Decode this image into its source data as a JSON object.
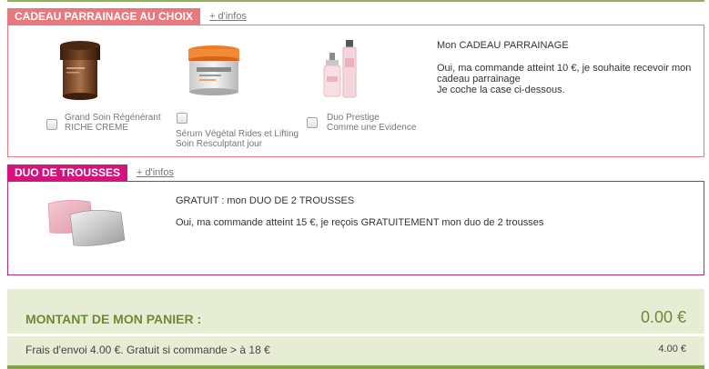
{
  "parrainage": {
    "tag": "CADEAU PARRAINAGE AU CHOIX",
    "info_link": "+ d'infos",
    "products": [
      {
        "line1": "Grand Soin Régénérant",
        "line2": "RICHE CREME",
        "checked": false,
        "icon": "cream-jar-icon"
      },
      {
        "line1": "Sérum Végétal Rides et Lifting",
        "line2": "Soin Resculptant jour",
        "checked": false,
        "icon": "serum-jar-icon"
      },
      {
        "line1": "Duo Prestige",
        "line2": "Comme une Evidence",
        "checked": false,
        "icon": "perfume-duo-icon"
      }
    ],
    "title": "Mon CADEAU PARRAINAGE",
    "text_line1": "Oui, ma commande atteint 10 €, je souhaite recevoir mon",
    "text_line2": "cadeau parrainage",
    "text_line3": "Je coche la case ci-dessous."
  },
  "trousses": {
    "tag": "DUO DE TROUSSES",
    "info_link": "+ d'infos",
    "icon": "pouches-icon",
    "title": "GRATUIT : mon DUO DE 2 TROUSSES",
    "text": "Oui, ma commande atteint 15 €, je reçois GRATUITEMENT mon duo de 2 trousses"
  },
  "summary": {
    "total_label": "MONTANT DE MON PANIER :",
    "total_value": "0.00 €",
    "shipping_label": "Frais d'envoi 4.00 €. Gratuit si commande > à 18 €",
    "shipping_value": "4.00 €"
  },
  "colors": {
    "parrainage_accent": "#e8787d",
    "trousses_accent": "#d4147d",
    "summary_bg": "#e7ecd5",
    "summary_text": "#6f8a37"
  }
}
